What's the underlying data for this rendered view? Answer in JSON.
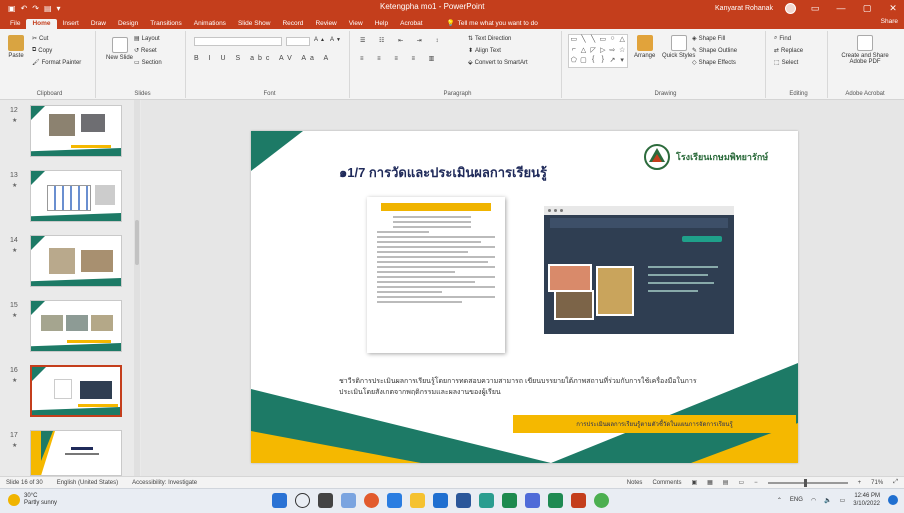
{
  "window": {
    "doc_title": "Ketengpha mo1 - PowerPoint",
    "user_name": "Kanyarat Rohanak",
    "share_label": "Share",
    "min_glyph": "—",
    "max_glyph": "▢",
    "close_glyph": "✕"
  },
  "tabs": [
    "File",
    "Home",
    "Insert",
    "Draw",
    "Design",
    "Transitions",
    "Animations",
    "Slide Show",
    "Record",
    "Review",
    "View",
    "Help",
    "Acrobat"
  ],
  "active_tab": "Home",
  "tell_me": "Tell me what you want to do",
  "ribbon": {
    "clipboard": {
      "label": "Clipboard",
      "paste": "Paste",
      "cut": "Cut",
      "copy": "Copy",
      "format_painter": "Format Painter"
    },
    "slides": {
      "label": "Slides",
      "new_slide": "New Slide",
      "layout": "Layout",
      "reset": "Reset",
      "section": "Section"
    },
    "font": {
      "label": "Font",
      "format_glyphs": "B I U S abc AV Aa A"
    },
    "paragraph": {
      "label": "Paragraph",
      "text_direction": "Text Direction",
      "align_text": "Align Text",
      "convert_smartart": "Convert to SmartArt"
    },
    "drawing": {
      "label": "Drawing",
      "arrange": "Arrange",
      "quick_styles": "Quick Styles",
      "shape_fill": "Shape Fill",
      "shape_outline": "Shape Outline",
      "shape_effects": "Shape Effects"
    },
    "editing": {
      "label": "Editing",
      "find": "Find",
      "replace": "Replace",
      "select": "Select"
    },
    "adobe": {
      "label": "Adobe Acrobat",
      "create_share": "Create and Share Adobe PDF"
    }
  },
  "thumbnails": [
    {
      "number": "12"
    },
    {
      "number": "13"
    },
    {
      "number": "14"
    },
    {
      "number": "15"
    },
    {
      "number": "16"
    },
    {
      "number": "17"
    }
  ],
  "slide": {
    "title": "๑1/7 การวัดและประเมินผลการเรียนรู้",
    "logo_text": "โรงเรียนเกษมพิทยารักษ์",
    "description": "ชาวีรติการประเมินผลการเรียนรู้โดยการทดสอบความสามารถ เขียนบรรยายใต้ภาพสถานที่ร่วมกับการใช้เครื่องมือในการประเมินโดยสังเกตจากพฤติกรรมและผลงานของผู้เรียน",
    "banner": "การประเมินผลการเรียนรู้ตามตัวชี้วัดในแผนการจัดการเรียนรู้"
  },
  "status": {
    "slide_info": "Slide 16 of 30",
    "language": "English (United States)",
    "accessibility": "Accessibility: Investigate",
    "notes": "Notes",
    "comments": "Comments",
    "zoom": "71%"
  },
  "taskbar": {
    "weather_temp": "30°C",
    "weather_desc": "Partly sunny",
    "time": "12:46 PM",
    "date": "3/10/2022",
    "lang": "ENG"
  },
  "colors": {
    "accent": "#c43e1c",
    "slide_title": "#1f2a5a",
    "teal": "#1d7a66",
    "banner": "#f5b800"
  }
}
